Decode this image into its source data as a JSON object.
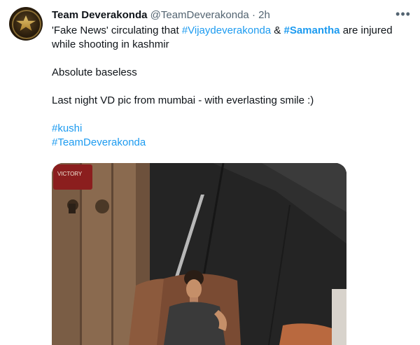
{
  "tweet": {
    "author_name": "Team Deverakonda",
    "author_handle": "@TeamDeverakonda",
    "separator": "·",
    "time": "2h",
    "more_icon": "more-options-icon",
    "line1_prefix": "'Fake News' circulating that ",
    "hashtag1": "#Vijaydeverakonda",
    "line1_middle": " & ",
    "hashtag2": "#Samantha",
    "line1_suffix": " are injured",
    "line2": "while shooting in kashmir",
    "line3": "Absolute baseless",
    "line4": "Last night VD pic from mumbai - with everlasting smile :)",
    "hashtag3": "#kushi",
    "hashtag4": "#TeamDeverakonda",
    "media_sign_text": "VICTORY"
  },
  "colors": {
    "text": "#0f1419",
    "secondary": "#536471",
    "link": "#1d9bf0"
  }
}
